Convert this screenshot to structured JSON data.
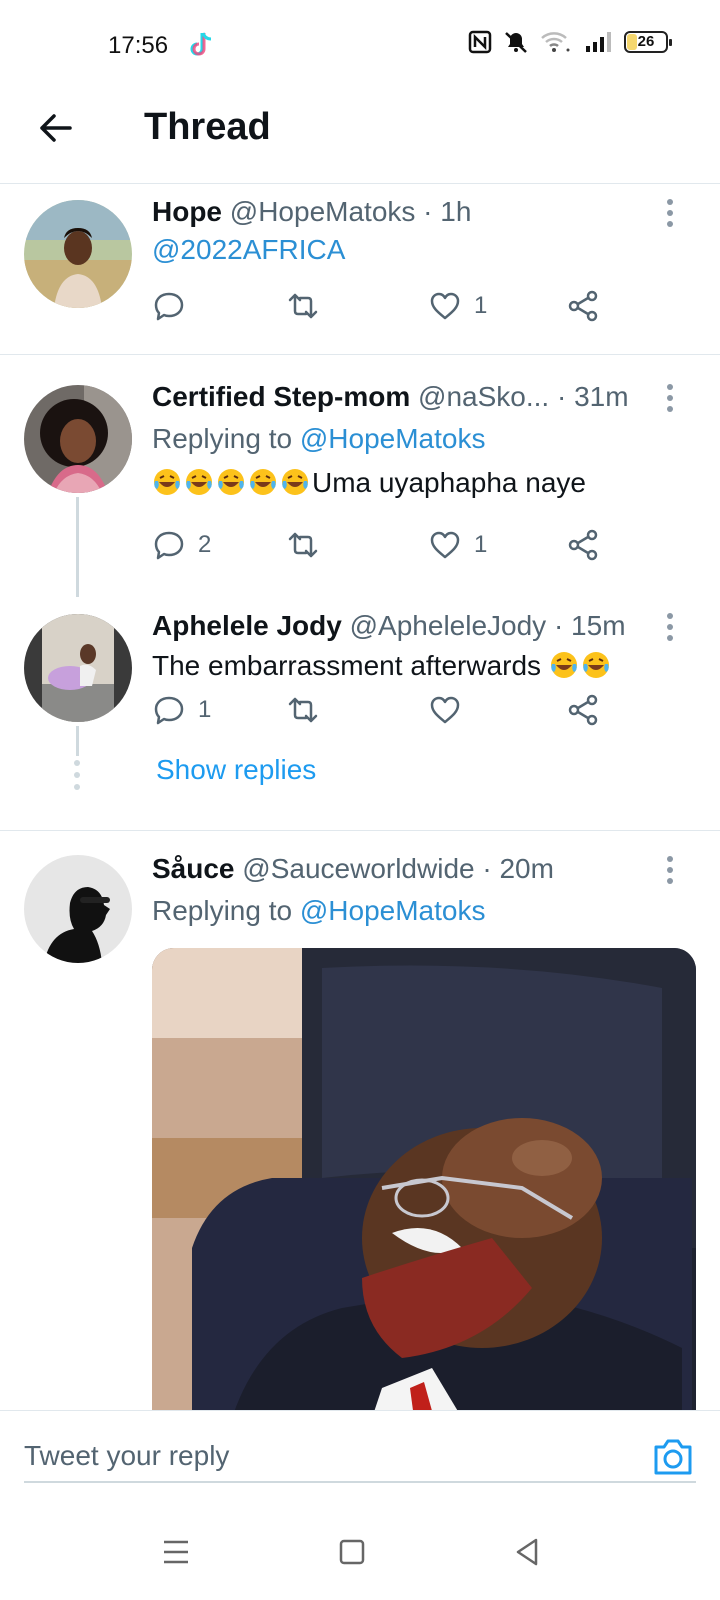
{
  "status_bar": {
    "time": "17:56",
    "battery": "26",
    "battery_level": 0.26
  },
  "header": {
    "title": "Thread"
  },
  "tweets": [
    {
      "name": "Hope",
      "handle": "@HopeMatoks",
      "time": "· 1h",
      "text": "@2022AFRICA",
      "reply_count": "",
      "like_count": "1"
    },
    {
      "name": "Certified Step-mom",
      "handle": "@naSko...",
      "time": "· 31m",
      "replying_prefix": "Replying to",
      "replying_to": "@HopeMatoks",
      "text": "Uma uyaphapha naye",
      "reply_count": "2",
      "like_count": "1"
    },
    {
      "name": "Aphelele Jody",
      "handle": "@ApheleleJody",
      "time": "· 15m",
      "text": "The embarrassment afterwards",
      "reply_count": "1",
      "like_count": ""
    },
    {
      "name": "Såuce",
      "handle": "@Sauceworldwide",
      "time": "· 20m",
      "replying_prefix": "Replying to",
      "replying_to": "@HopeMatoks"
    }
  ],
  "show_replies": "Show replies",
  "reply_bar": {
    "placeholder": "Tweet your reply"
  },
  "colors": {
    "accent": "#1d9bf0",
    "text": "#0f1419",
    "muted": "#536471",
    "divider": "#e1e8ed"
  }
}
